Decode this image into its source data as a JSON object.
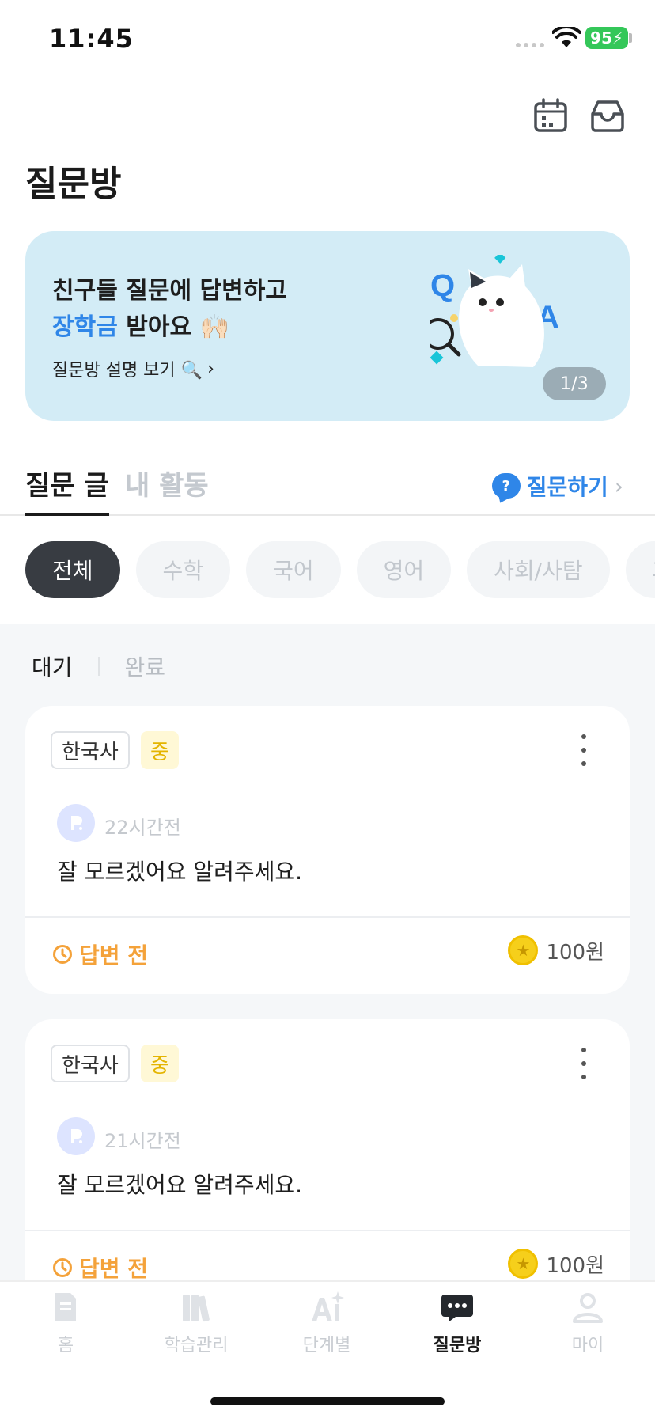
{
  "status_bar": {
    "time": "11:45",
    "battery": "95"
  },
  "header": {
    "title": "질문방",
    "calendar_icon": "calendar-icon",
    "inbox_icon": "inbox-icon"
  },
  "banner": {
    "line1": "친구들 질문에 답변하고",
    "line2_accent": "장학금",
    "line2_rest": " 받아요 🙌🏻",
    "link_label": "질문방 설명 보기 🔍",
    "art_q": "Q",
    "art_a": "A",
    "pager": "1/3"
  },
  "tabs": {
    "items": [
      {
        "label": "질문 글",
        "active": true
      },
      {
        "label": "내 활동",
        "active": false
      }
    ],
    "ask_label": "질문하기",
    "ask_badge": "?"
  },
  "chips": [
    {
      "label": "전체",
      "active": true
    },
    {
      "label": "수학"
    },
    {
      "label": "국어"
    },
    {
      "label": "영어"
    },
    {
      "label": "사회/사탐"
    },
    {
      "label": "과"
    }
  ],
  "status_filter": {
    "waiting": "대기",
    "done": "완료"
  },
  "questions": [
    {
      "subject": "한국사",
      "level": "중",
      "time_ago": "22시간전",
      "text": "잘 모르겠어요 알려주세요.",
      "answer_status": "답변 전",
      "reward": "100원"
    },
    {
      "subject": "한국사",
      "level": "중",
      "time_ago": "21시간전",
      "text": "잘 모르겠어요 알려주세요.",
      "answer_status": "답변 전",
      "reward": "100원"
    }
  ],
  "bottom_nav": [
    {
      "label": "홈",
      "icon": "home-icon"
    },
    {
      "label": "학습관리",
      "icon": "books-icon"
    },
    {
      "label": "단계별",
      "icon": "ai-icon"
    },
    {
      "label": "질문방",
      "icon": "chat-icon",
      "active": true
    },
    {
      "label": "마이",
      "icon": "person-icon"
    }
  ],
  "colors": {
    "accent": "#2f86e8",
    "banner_bg": "#d3ecf6",
    "answer_status": "#f4a23a",
    "level_tag": "#e4b400",
    "coin": "#f6cf1b"
  }
}
